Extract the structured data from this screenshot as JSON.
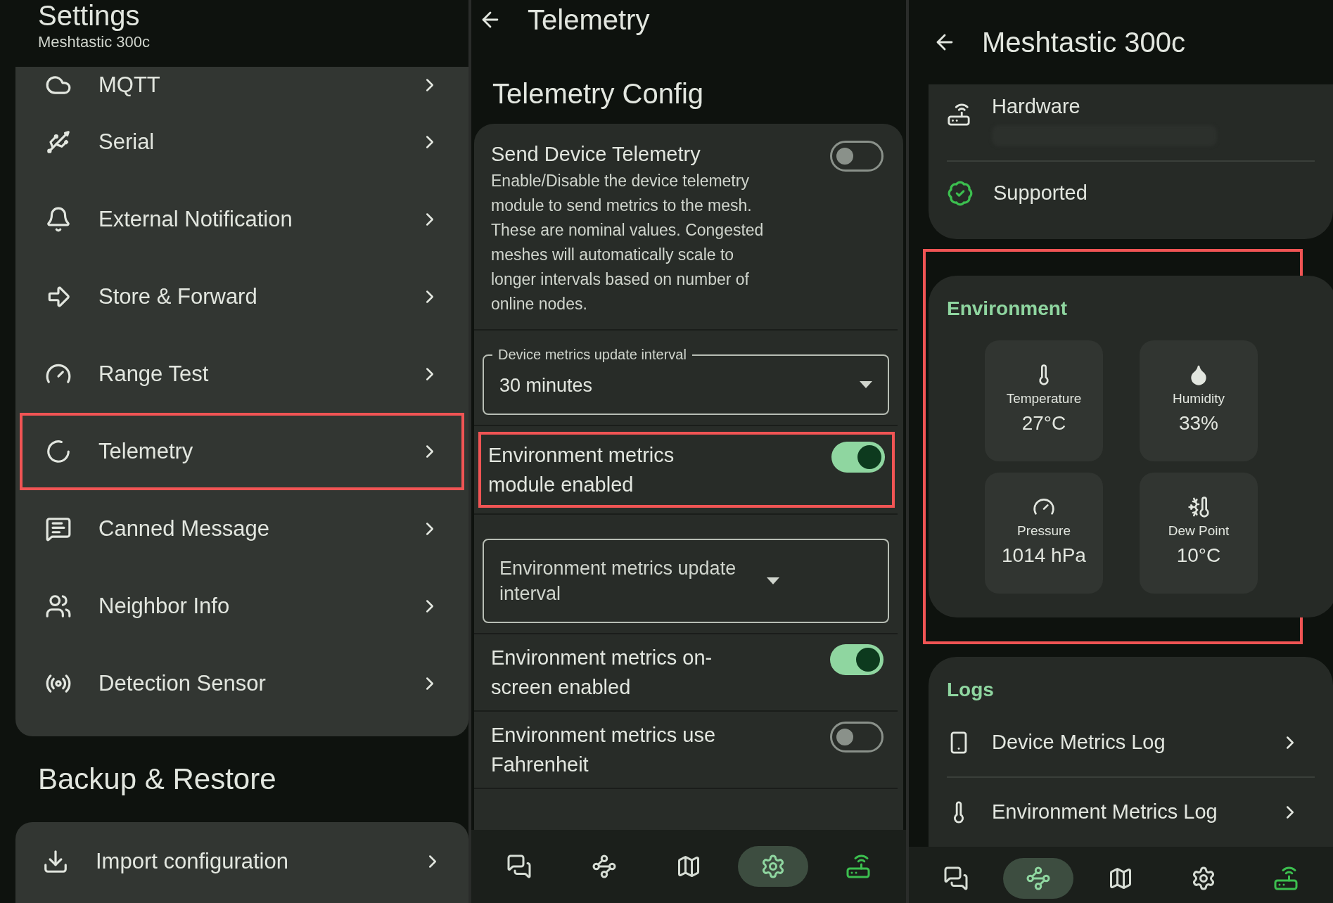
{
  "settings_screen": {
    "title": "Settings",
    "subtitle": "Meshtastic 300c",
    "items": [
      {
        "label": "MQTT",
        "highlighted": false
      },
      {
        "label": "Serial",
        "highlighted": false
      },
      {
        "label": "External Notification",
        "highlighted": false
      },
      {
        "label": "Store & Forward",
        "highlighted": false
      },
      {
        "label": "Range Test",
        "highlighted": false
      },
      {
        "label": "Telemetry",
        "highlighted": true
      },
      {
        "label": "Canned Message",
        "highlighted": false
      },
      {
        "label": "Neighbor Info",
        "highlighted": false
      },
      {
        "label": "Detection Sensor",
        "highlighted": false
      }
    ],
    "backup_section": {
      "title": "Backup & Restore",
      "items": [
        {
          "label": "Import configuration"
        }
      ]
    }
  },
  "telemetry_screen": {
    "title": "Telemetry",
    "section_title": "Telemetry Config",
    "rows": [
      {
        "kind": "toggle",
        "title": "Send Device Telemetry",
        "description": "Enable/Disable the device telemetry module to send metrics to the mesh. These are nominal values. Congested meshes will automatically scale to longer intervals based on number of online nodes.",
        "on": false,
        "highlighted": false
      },
      {
        "kind": "dropdown",
        "label": "Device metrics update interval",
        "value": "30 minutes"
      },
      {
        "kind": "toggle",
        "title": "Environment metrics module enabled",
        "on": true,
        "highlighted": true
      },
      {
        "kind": "dropdown",
        "label": "Environment metrics update interval"
      },
      {
        "kind": "toggle",
        "title": "Environment metrics on-screen enabled",
        "on": true,
        "highlighted": false
      },
      {
        "kind": "toggle",
        "title": "Environment metrics use Fahrenheit",
        "on": false,
        "highlighted": false
      }
    ],
    "nav": [
      {
        "selected": false
      },
      {
        "selected": false
      },
      {
        "selected": false
      },
      {
        "selected": true
      },
      {
        "selected": false
      }
    ]
  },
  "node_screen": {
    "title": "Meshtastic 300c",
    "device_rows": [
      "Hardware",
      "Supported"
    ],
    "environment": {
      "title": "Environment",
      "highlighted": true,
      "tiles": [
        {
          "label": "Temperature",
          "value": "27°C"
        },
        {
          "label": "Humidity",
          "value": "33%"
        },
        {
          "label": "Pressure",
          "value": "1014 hPa"
        },
        {
          "label": "Dew Point",
          "value": "10°C"
        }
      ]
    },
    "logs": {
      "title": "Logs",
      "items": [
        "Device Metrics Log",
        "Environment Metrics Log"
      ]
    },
    "nav": [
      {
        "selected": false
      },
      {
        "selected": true
      },
      {
        "selected": false
      },
      {
        "selected": false
      },
      {
        "selected": false
      }
    ]
  }
}
